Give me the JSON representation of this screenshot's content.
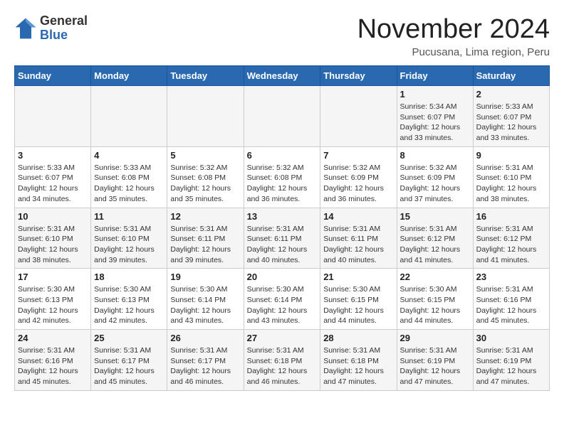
{
  "header": {
    "logo_general": "General",
    "logo_blue": "Blue",
    "month_title": "November 2024",
    "location": "Pucusana, Lima region, Peru"
  },
  "calendar": {
    "weekdays": [
      "Sunday",
      "Monday",
      "Tuesday",
      "Wednesday",
      "Thursday",
      "Friday",
      "Saturday"
    ],
    "weeks": [
      [
        {
          "day": "",
          "info": ""
        },
        {
          "day": "",
          "info": ""
        },
        {
          "day": "",
          "info": ""
        },
        {
          "day": "",
          "info": ""
        },
        {
          "day": "",
          "info": ""
        },
        {
          "day": "1",
          "info": "Sunrise: 5:34 AM\nSunset: 6:07 PM\nDaylight: 12 hours and 33 minutes."
        },
        {
          "day": "2",
          "info": "Sunrise: 5:33 AM\nSunset: 6:07 PM\nDaylight: 12 hours and 33 minutes."
        }
      ],
      [
        {
          "day": "3",
          "info": "Sunrise: 5:33 AM\nSunset: 6:07 PM\nDaylight: 12 hours and 34 minutes."
        },
        {
          "day": "4",
          "info": "Sunrise: 5:33 AM\nSunset: 6:08 PM\nDaylight: 12 hours and 35 minutes."
        },
        {
          "day": "5",
          "info": "Sunrise: 5:32 AM\nSunset: 6:08 PM\nDaylight: 12 hours and 35 minutes."
        },
        {
          "day": "6",
          "info": "Sunrise: 5:32 AM\nSunset: 6:08 PM\nDaylight: 12 hours and 36 minutes."
        },
        {
          "day": "7",
          "info": "Sunrise: 5:32 AM\nSunset: 6:09 PM\nDaylight: 12 hours and 36 minutes."
        },
        {
          "day": "8",
          "info": "Sunrise: 5:32 AM\nSunset: 6:09 PM\nDaylight: 12 hours and 37 minutes."
        },
        {
          "day": "9",
          "info": "Sunrise: 5:31 AM\nSunset: 6:10 PM\nDaylight: 12 hours and 38 minutes."
        }
      ],
      [
        {
          "day": "10",
          "info": "Sunrise: 5:31 AM\nSunset: 6:10 PM\nDaylight: 12 hours and 38 minutes."
        },
        {
          "day": "11",
          "info": "Sunrise: 5:31 AM\nSunset: 6:10 PM\nDaylight: 12 hours and 39 minutes."
        },
        {
          "day": "12",
          "info": "Sunrise: 5:31 AM\nSunset: 6:11 PM\nDaylight: 12 hours and 39 minutes."
        },
        {
          "day": "13",
          "info": "Sunrise: 5:31 AM\nSunset: 6:11 PM\nDaylight: 12 hours and 40 minutes."
        },
        {
          "day": "14",
          "info": "Sunrise: 5:31 AM\nSunset: 6:11 PM\nDaylight: 12 hours and 40 minutes."
        },
        {
          "day": "15",
          "info": "Sunrise: 5:31 AM\nSunset: 6:12 PM\nDaylight: 12 hours and 41 minutes."
        },
        {
          "day": "16",
          "info": "Sunrise: 5:31 AM\nSunset: 6:12 PM\nDaylight: 12 hours and 41 minutes."
        }
      ],
      [
        {
          "day": "17",
          "info": "Sunrise: 5:30 AM\nSunset: 6:13 PM\nDaylight: 12 hours and 42 minutes."
        },
        {
          "day": "18",
          "info": "Sunrise: 5:30 AM\nSunset: 6:13 PM\nDaylight: 12 hours and 42 minutes."
        },
        {
          "day": "19",
          "info": "Sunrise: 5:30 AM\nSunset: 6:14 PM\nDaylight: 12 hours and 43 minutes."
        },
        {
          "day": "20",
          "info": "Sunrise: 5:30 AM\nSunset: 6:14 PM\nDaylight: 12 hours and 43 minutes."
        },
        {
          "day": "21",
          "info": "Sunrise: 5:30 AM\nSunset: 6:15 PM\nDaylight: 12 hours and 44 minutes."
        },
        {
          "day": "22",
          "info": "Sunrise: 5:30 AM\nSunset: 6:15 PM\nDaylight: 12 hours and 44 minutes."
        },
        {
          "day": "23",
          "info": "Sunrise: 5:31 AM\nSunset: 6:16 PM\nDaylight: 12 hours and 45 minutes."
        }
      ],
      [
        {
          "day": "24",
          "info": "Sunrise: 5:31 AM\nSunset: 6:16 PM\nDaylight: 12 hours and 45 minutes."
        },
        {
          "day": "25",
          "info": "Sunrise: 5:31 AM\nSunset: 6:17 PM\nDaylight: 12 hours and 45 minutes."
        },
        {
          "day": "26",
          "info": "Sunrise: 5:31 AM\nSunset: 6:17 PM\nDaylight: 12 hours and 46 minutes."
        },
        {
          "day": "27",
          "info": "Sunrise: 5:31 AM\nSunset: 6:18 PM\nDaylight: 12 hours and 46 minutes."
        },
        {
          "day": "28",
          "info": "Sunrise: 5:31 AM\nSunset: 6:18 PM\nDaylight: 12 hours and 47 minutes."
        },
        {
          "day": "29",
          "info": "Sunrise: 5:31 AM\nSunset: 6:19 PM\nDaylight: 12 hours and 47 minutes."
        },
        {
          "day": "30",
          "info": "Sunrise: 5:31 AM\nSunset: 6:19 PM\nDaylight: 12 hours and 47 minutes."
        }
      ]
    ]
  }
}
